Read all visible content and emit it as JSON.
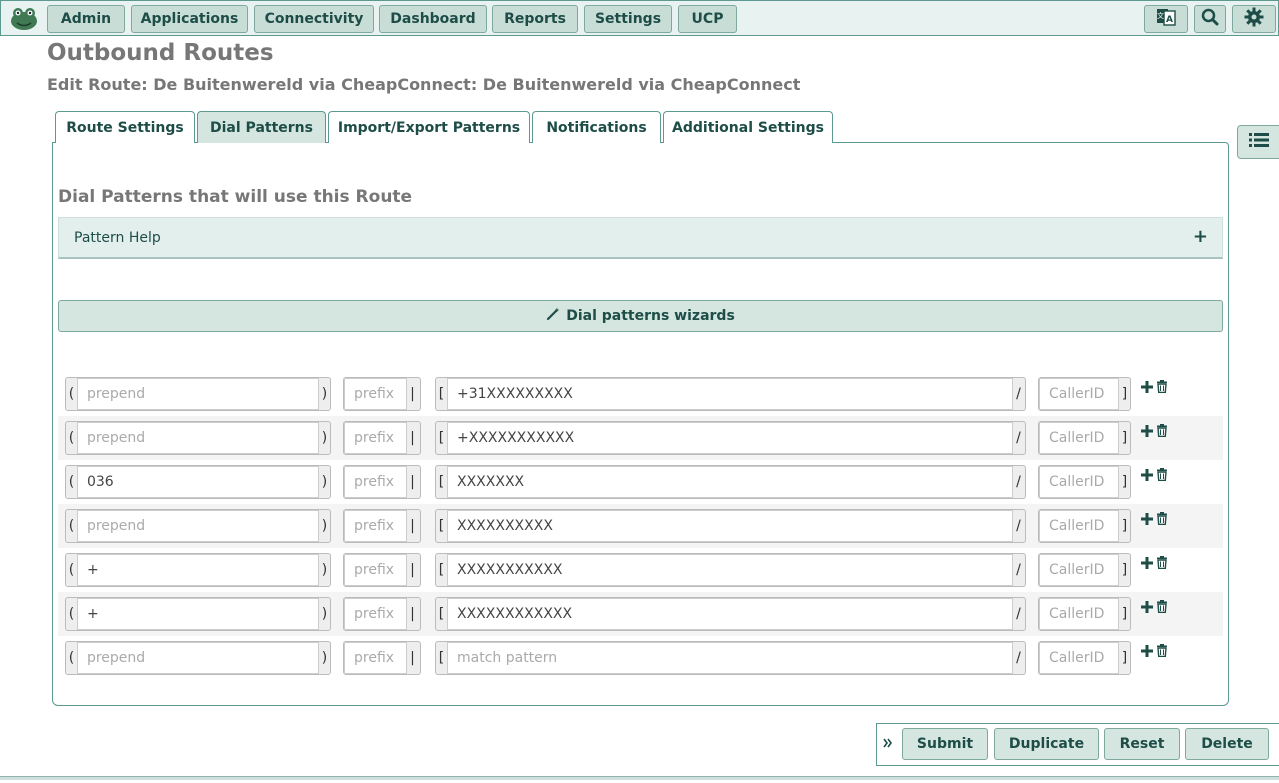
{
  "nav": {
    "items": [
      "Admin",
      "Applications",
      "Connectivity",
      "Dashboard",
      "Reports",
      "Settings",
      "UCP"
    ],
    "icons": [
      "translate-icon",
      "search-icon",
      "gear-icon"
    ]
  },
  "page": {
    "title": "Outbound Routes",
    "subtitle": "Edit Route: De Buitenwereld via CheapConnect: De Buitenwereld via CheapConnect"
  },
  "tabs": [
    "Route Settings",
    "Dial Patterns",
    "Import/Export Patterns",
    "Notifications",
    "Additional Settings"
  ],
  "active_tab": "Dial Patterns",
  "section": {
    "heading": "Dial Patterns that will use this Route",
    "pattern_help": "Pattern Help",
    "wizard_label": "Dial patterns wizards"
  },
  "placeholders": {
    "prepend": "prepend",
    "prefix": "prefix",
    "match": "match pattern",
    "callerid": "CallerID"
  },
  "rows": [
    {
      "prepend": "",
      "prefix": "",
      "match": "+31XXXXXXXXX",
      "callerid": ""
    },
    {
      "prepend": "",
      "prefix": "",
      "match": "+XXXXXXXXXXX",
      "callerid": ""
    },
    {
      "prepend": "036",
      "prefix": "",
      "match": "XXXXXXX",
      "callerid": ""
    },
    {
      "prepend": "",
      "prefix": "",
      "match": "XXXXXXXXXX",
      "callerid": ""
    },
    {
      "prepend": "+",
      "prefix": "",
      "match": "XXXXXXXXXXX",
      "callerid": ""
    },
    {
      "prepend": "+",
      "prefix": "",
      "match": "XXXXXXXXXXXX",
      "callerid": ""
    },
    {
      "prepend": "",
      "prefix": "",
      "match": "",
      "callerid": ""
    }
  ],
  "footer": {
    "submit": "Submit",
    "duplicate": "Duplicate",
    "reset": "Reset",
    "delete": "Delete"
  },
  "colors": {
    "accent": "#1e4d48",
    "button_bg": "#c9ddd7",
    "border": "#5c9a8f"
  }
}
